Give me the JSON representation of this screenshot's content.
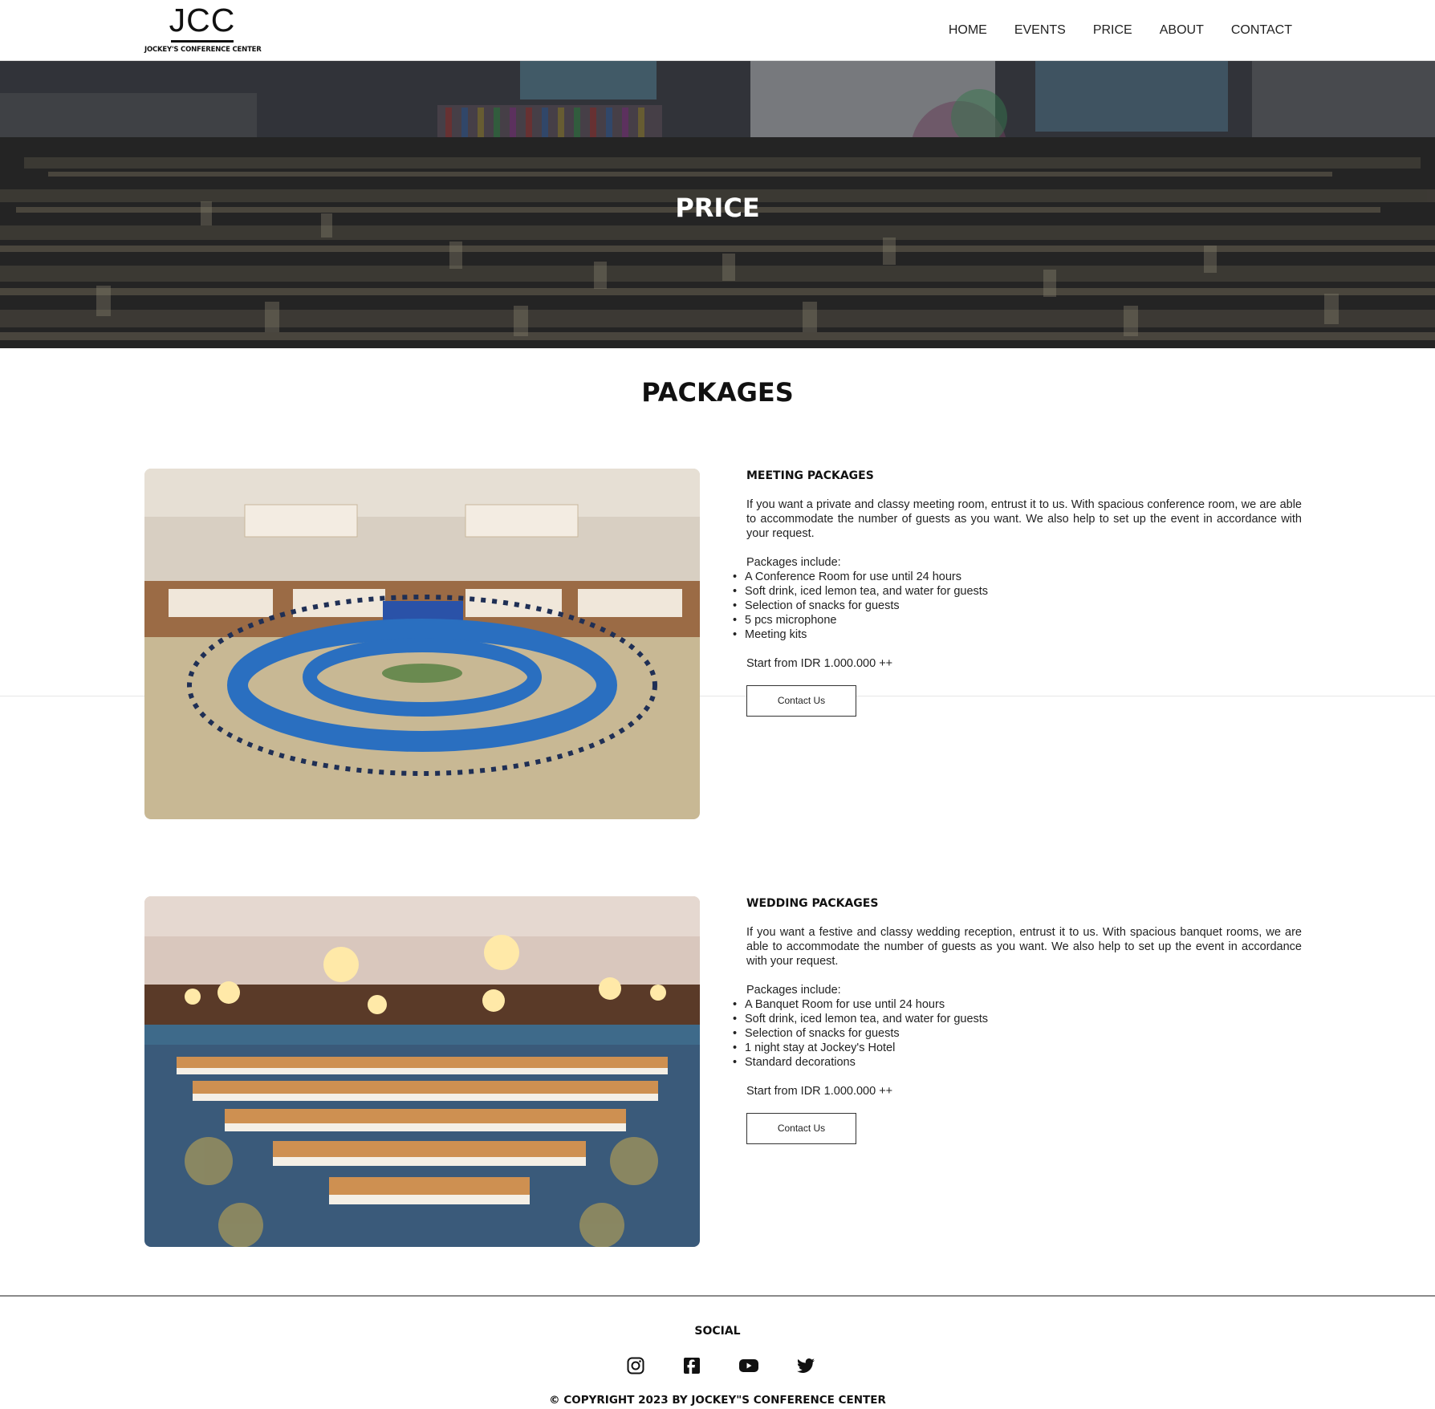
{
  "header": {
    "logo_mark": "JCC",
    "logo_sub": "JOCKEY'S CONFERENCE CENTER",
    "nav": [
      "HOME",
      "EVENTS",
      "PRICE",
      "ABOUT",
      "CONTACT"
    ]
  },
  "hero": {
    "title": "PRICE"
  },
  "packages": {
    "title": "PACKAGES",
    "meeting": {
      "title": "MEETING PACKAGES",
      "description": "If you want a private and classy meeting room, entrust it to us. With spacious conference room, we are able to accommodate the number of guests as you want. We also help to set up the event in accordance with your request.",
      "include_label": "Packages include:",
      "items": [
        "A Conference Room for use until 24 hours",
        "Soft drink, iced lemon tea, and water for guests",
        "Selection of snacks for guests",
        "5 pcs microphone",
        "Meeting kits"
      ],
      "price": "Start from IDR 1.000.000 ++",
      "button": "Contact Us"
    },
    "wedding": {
      "title": "WEDDING PACKAGES",
      "description": "If you want a festive and classy wedding reception, entrust it to us. With spacious banquet rooms, we are able to accommodate the number of guests as you want. We also help to set up the event in accordance with your request.",
      "include_label": "Packages include:",
      "items": [
        "A Banquet Room for use until 24 hours",
        "Soft drink, iced lemon tea, and water for guests",
        "Selection of snacks for guests",
        "1 night stay at Jockey's Hotel",
        "Standard decorations"
      ],
      "price": "Start from IDR 1.000.000 ++",
      "button": "Contact Us"
    }
  },
  "footer": {
    "social_title": "SOCIAL",
    "icons": [
      "instagram-icon",
      "facebook-icon",
      "youtube-icon",
      "twitter-icon"
    ],
    "copyright": "© COPYRIGHT 2023 BY JOCKEY\"S CONFERENCE CENTER"
  }
}
